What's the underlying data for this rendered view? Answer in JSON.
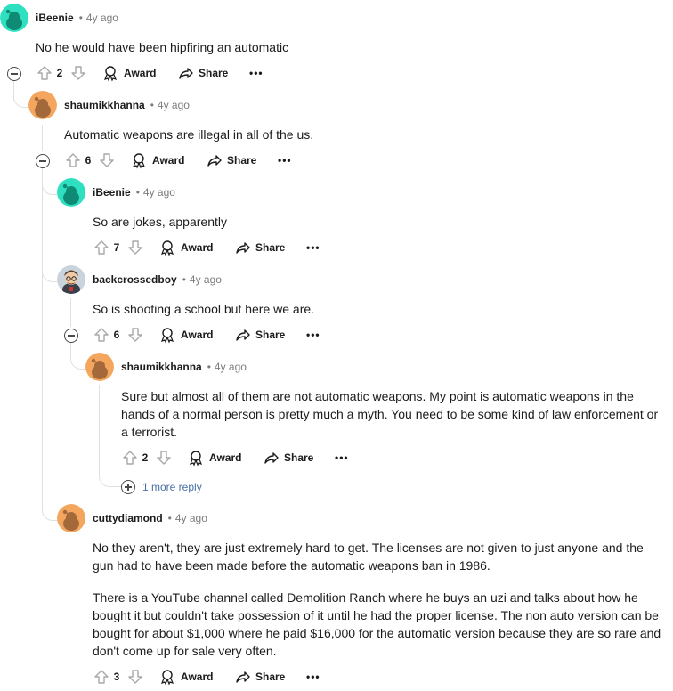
{
  "comments": [
    {
      "username": "iBeenie",
      "time": "4y ago",
      "avatar_color": "#2ee0c0",
      "body": [
        "No he would have been hipfiring an automatic"
      ],
      "votes": "2"
    },
    {
      "username": "shaumikkhanna",
      "time": "4y ago",
      "avatar_color": "#f4a55e",
      "body": [
        "Automatic weapons are illegal in all of the us."
      ],
      "votes": "6"
    },
    {
      "username": "iBeenie",
      "time": "4y ago",
      "avatar_color": "#2ee0c0",
      "body": [
        "So are jokes, apparently"
      ],
      "votes": "7"
    },
    {
      "username": "backcrossedboy",
      "time": "4y ago",
      "avatar_color": "#c9d3dc",
      "body": [
        "So is shooting a school but here we are."
      ],
      "votes": "6"
    },
    {
      "username": "shaumikkhanna",
      "time": "4y ago",
      "avatar_color": "#f4a55e",
      "body": [
        "Sure but almost all of them are not automatic weapons. My point is automatic weapons in the hands of a normal person is pretty much a myth. You need to be some kind of law enforcement or a terrorist."
      ],
      "votes": "2"
    },
    {
      "username": "cuttydiamond",
      "time": "4y ago",
      "avatar_color": "#f4a55e",
      "body": [
        "No they aren't, they are just extremely hard to get. The licenses are not given to just anyone and the gun had to have been made before the automatic weapons ban in 1986.",
        "There is a YouTube channel called Demolition Ranch where he buys an uzi and talks about how he bought it but couldn't take possession of it until he had the proper license. The non auto version can be bought for about $1,000 where he paid $16,000 for the automatic version because they are so rare and don't come up for sale very often."
      ],
      "votes": "3"
    }
  ],
  "actions": {
    "award": "Award",
    "share": "Share",
    "more": "•••"
  },
  "more_replies": "1 more reply",
  "colors": {
    "thread_line": "#e0e0e0",
    "link": "#4a6fa5",
    "meta": "#7c7c7c"
  }
}
